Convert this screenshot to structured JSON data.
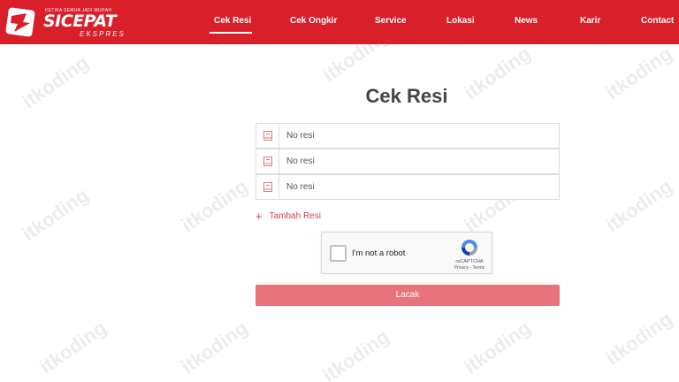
{
  "brand": {
    "tagline": "KETIKA SEMUA JADI MUDAH",
    "name": "SICEPAT",
    "sub": "EKSPRES"
  },
  "nav": {
    "items": [
      {
        "label": "Cek Resi",
        "active": true
      },
      {
        "label": "Cek Ongkir",
        "active": false
      },
      {
        "label": "Service",
        "active": false
      },
      {
        "label": "Lokasi",
        "active": false
      },
      {
        "label": "News",
        "active": false
      },
      {
        "label": "Karir",
        "active": false
      },
      {
        "label": "Contact",
        "active": false
      }
    ]
  },
  "watermark": "itkoding",
  "form": {
    "title": "Cek Resi",
    "rows": [
      {
        "placeholder": "No resi",
        "icon": "package-icon"
      },
      {
        "placeholder": "No resi",
        "icon": "package-icon"
      },
      {
        "placeholder": "No resi",
        "icon": "package-icon"
      }
    ],
    "add_label": "Tambah Resi",
    "captcha": {
      "label": "I'm not a robot",
      "brand": "reCAPTCHA",
      "links": "Privacy - Terms"
    },
    "submit_label": "Lacak"
  },
  "colors": {
    "brand_red": "#d81f2a",
    "button_pink": "#e7737c",
    "accent_red": "#e03a45"
  }
}
